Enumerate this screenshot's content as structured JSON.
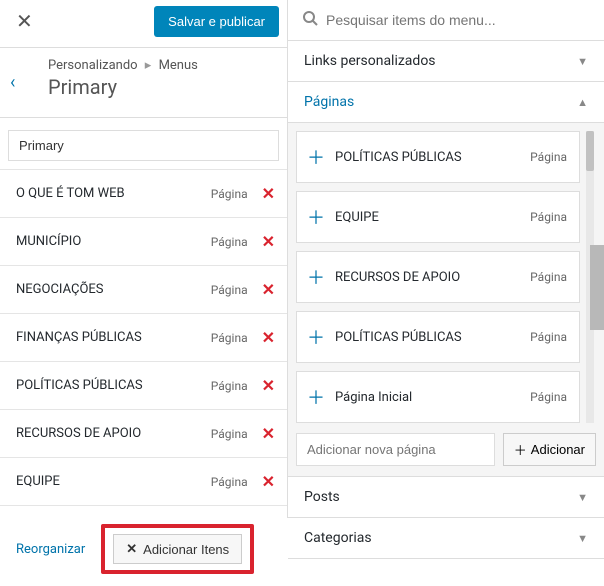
{
  "topbar": {
    "save_label": "Salvar e publicar"
  },
  "breadcrumb": {
    "customizing": "Personalizando",
    "menus": "Menus",
    "title": "Primary"
  },
  "menu_name": "Primary",
  "menu_items": [
    {
      "label": "O QUE É TOM WEB",
      "type": "Página"
    },
    {
      "label": "MUNICÍPIO",
      "type": "Página"
    },
    {
      "label": "NEGOCIAÇÕES",
      "type": "Página"
    },
    {
      "label": "FINANÇAS PÚBLICAS",
      "type": "Página"
    },
    {
      "label": "POLÍTICAS PÚBLICAS",
      "type": "Página"
    },
    {
      "label": "RECURSOS DE APOIO",
      "type": "Página"
    },
    {
      "label": "EQUIPE",
      "type": "Página"
    }
  ],
  "actions": {
    "reorganize": "Reorganizar",
    "add_items": "Adicionar Itens"
  },
  "search": {
    "placeholder": "Pesquisar items do menu..."
  },
  "sections": {
    "links": "Links personalizados",
    "pages": "Páginas",
    "posts": "Posts",
    "categories": "Categorias"
  },
  "available_pages": [
    {
      "label": "POLÍTICAS PÚBLICAS",
      "type": "Página"
    },
    {
      "label": "EQUIPE",
      "type": "Página"
    },
    {
      "label": "RECURSOS DE APOIO",
      "type": "Página"
    },
    {
      "label": "POLÍTICAS PÚBLICAS",
      "type": "Página"
    },
    {
      "label": "Página Inicial",
      "type": "Página"
    }
  ],
  "add_page": {
    "placeholder": "Adicionar nova página",
    "button": "Adicionar"
  }
}
